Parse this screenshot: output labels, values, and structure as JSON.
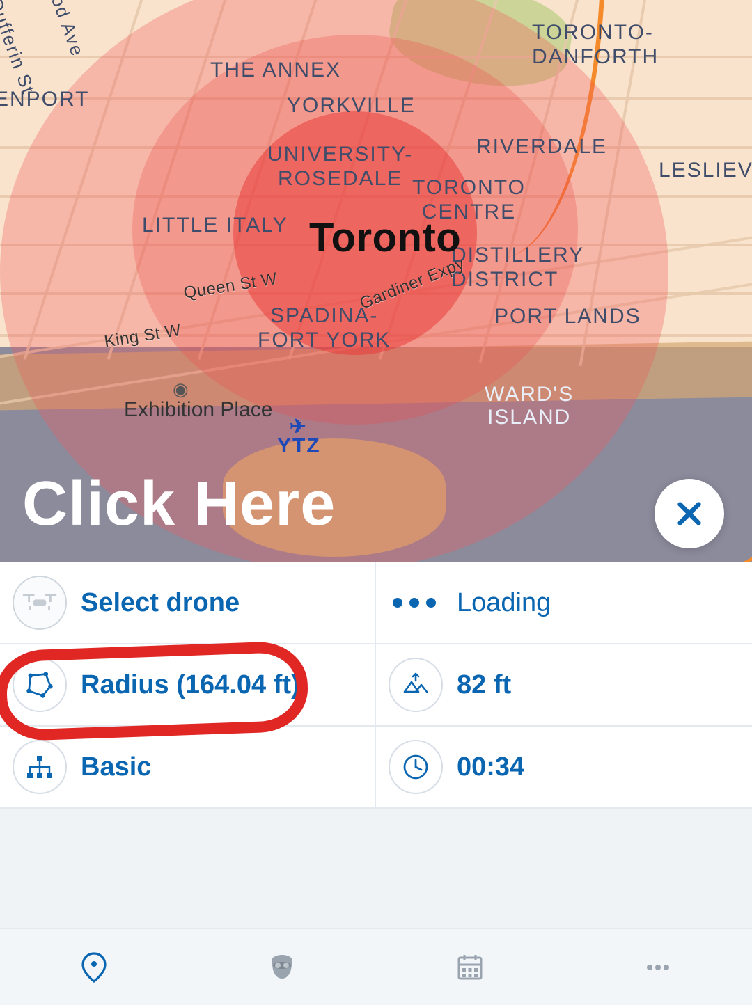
{
  "map": {
    "city": "Toronto",
    "labels": {
      "annex": "THE ANNEX",
      "yorkville": "YORKVILLE",
      "torontoDanforth": "TORONTO-\nDANFORTH",
      "riverdale": "RIVERDALE",
      "leslievi": "LESLIEVI",
      "universityRosedale": "UNIVERSITY-\nROSEDALE",
      "torontoCentre": "TORONTO\nCENTRE",
      "littleItaly": "LITTLE ITALY",
      "distillery": "DISTILLERY\nDISTRICT",
      "spadinaFortYork": "SPADINA-\nFORT YORK",
      "portLands": "PORT LANDS",
      "wardsIsland": "WARD'S\nISLAND",
      "davenport": "ENPORT",
      "exhibition": "Exhibition Place",
      "queenStW": "Queen St W",
      "kingStW": "King St W",
      "gardiner": "Gardiner Expy",
      "dufferin": "Dufferin St",
      "calgaryAve": "od Ave",
      "ytz": "YTZ"
    },
    "overlayText": "Click Here"
  },
  "panel": {
    "selectDrone": "Select drone",
    "loading": "Loading",
    "radius": "Radius (164.04 ft)",
    "altitude": "82 ft",
    "plan": "Basic",
    "duration": "00:34"
  },
  "colors": {
    "brand": "#0b66b2",
    "accent": "#e02724"
  }
}
